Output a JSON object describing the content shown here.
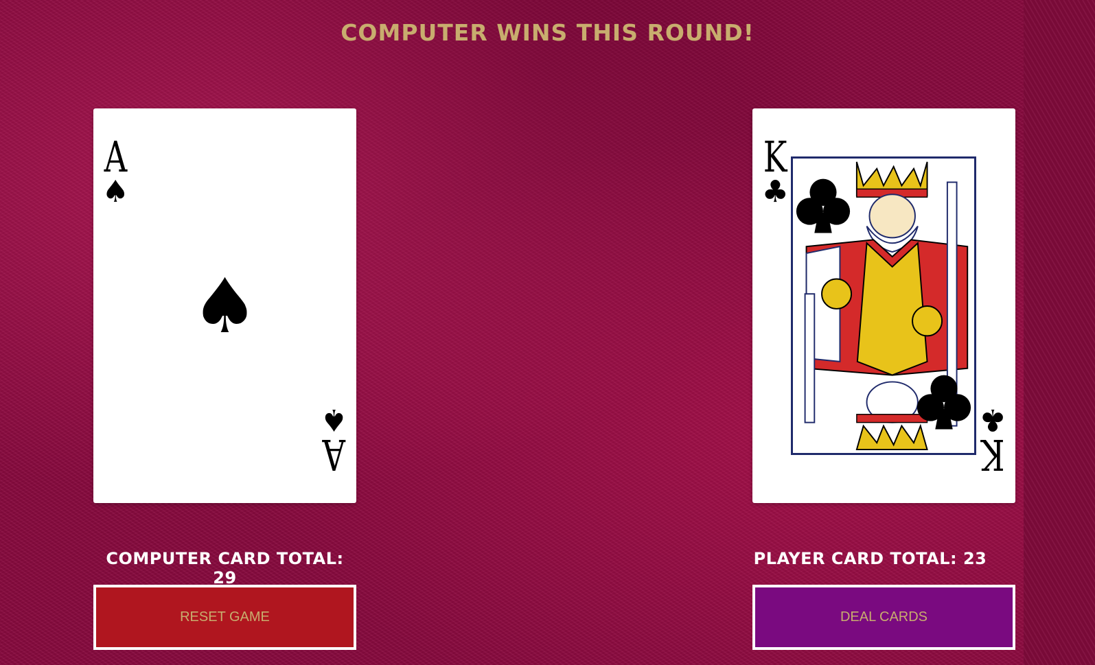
{
  "status_message": "Computer wins this round!",
  "computer": {
    "card": {
      "rank": "A",
      "suit": "♠",
      "suit_name": "spades",
      "color": "#000000"
    },
    "total_label": "Computer card total: 29"
  },
  "player": {
    "card": {
      "rank": "K",
      "suit": "♣",
      "suit_name": "clubs",
      "color": "#000000"
    },
    "total_label": "Player card total: 23"
  },
  "buttons": {
    "reset_label": "Reset Game",
    "deal_label": "Deal Cards"
  },
  "colors": {
    "background": "#8a0a3f",
    "accent_gold": "#c8ad6e",
    "reset_button": "#b0161f",
    "deal_button": "#7a0a80"
  }
}
